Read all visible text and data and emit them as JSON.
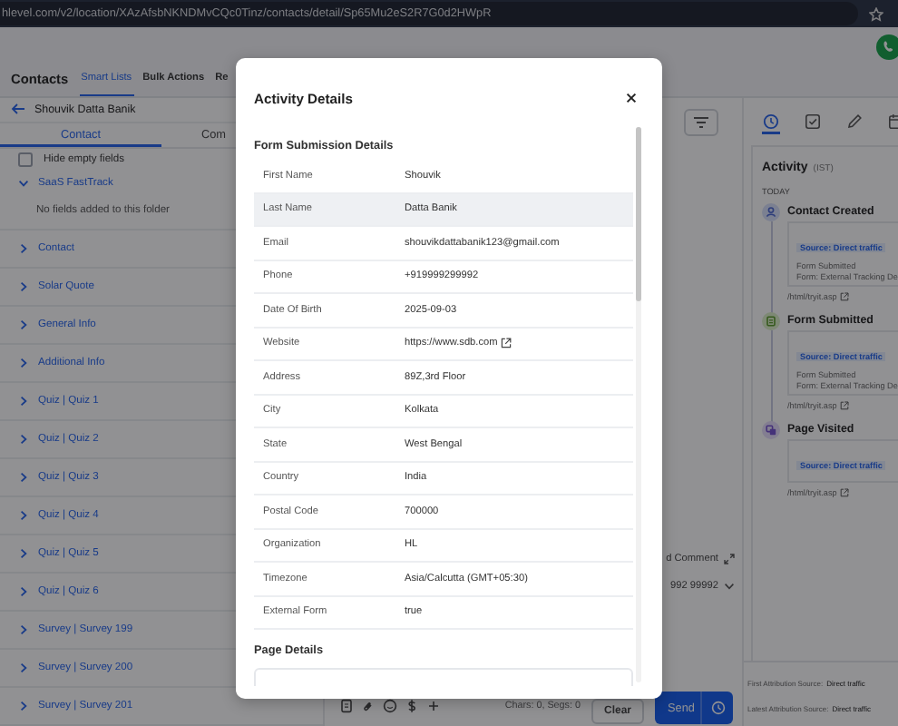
{
  "browser": {
    "url": "hlevel.com/v2/location/XAzAfsbNKNDMvCQc0Tinz/contacts/detail/Sp65Mu2eS2R7G0d2HWpR"
  },
  "nav": {
    "title": "Contacts",
    "tabs": [
      {
        "label": "Smart Lists",
        "selected": true
      },
      {
        "label": "Bulk Actions",
        "selected": false
      },
      {
        "label": "Re",
        "selected": false
      }
    ]
  },
  "contact_panel": {
    "name": "Shouvik Datta Banik",
    "tabs": [
      {
        "label": "Contact",
        "selected": true
      },
      {
        "label": "Com",
        "selected": false
      }
    ],
    "hide_empty": {
      "label": "Hide empty fields",
      "checked": false
    },
    "folders": [
      {
        "label": "SaaS FastTrack",
        "expanded": true,
        "empty_text": "No fields added to this folder"
      },
      {
        "label": "Contact",
        "expanded": false
      },
      {
        "label": "Solar Quote",
        "expanded": false
      },
      {
        "label": "General Info",
        "expanded": false
      },
      {
        "label": "Additional Info",
        "expanded": false
      },
      {
        "label": "Quiz | Quiz 1",
        "expanded": false
      },
      {
        "label": "Quiz | Quiz 2",
        "expanded": false
      },
      {
        "label": "Quiz | Quiz 3",
        "expanded": false
      },
      {
        "label": "Quiz | Quiz 4",
        "expanded": false
      },
      {
        "label": "Quiz | Quiz 5",
        "expanded": false
      },
      {
        "label": "Quiz | Quiz 6",
        "expanded": false
      },
      {
        "label": "Survey | Survey 199",
        "expanded": false
      },
      {
        "label": "Survey | Survey 200",
        "expanded": false
      },
      {
        "label": "Survey | Survey 201",
        "expanded": false
      }
    ]
  },
  "composer": {
    "comment_label": "d Comment",
    "phone": "992 99992",
    "counter": "Chars: 0, Segs: 0",
    "clear": "Clear",
    "send": "Send"
  },
  "activity": {
    "tabs": [
      {
        "selected": true
      },
      {
        "selected": false
      },
      {
        "selected": false
      },
      {
        "selected": false
      }
    ],
    "title": "Activity",
    "timezone": "(IST)",
    "day": "TODAY",
    "events": [
      {
        "kind": "contact",
        "title": "Contact Created",
        "source": "Source: Direct traffic",
        "lines": [
          "Form Submitted",
          "Form: External Tracking De"
        ],
        "link": "/html/tryit.asp"
      },
      {
        "kind": "form",
        "title": "Form Submitted",
        "source": "Source: Direct traffic",
        "lines": [
          "Form Submitted",
          "Form: External Tracking De"
        ],
        "link": "/html/tryit.asp"
      },
      {
        "kind": "page",
        "title": "Page Visited",
        "source": "Source: Direct traffic",
        "link": "/html/tryit.asp"
      }
    ],
    "attribution": [
      {
        "label": "First Attribution Source:",
        "value": "Direct traffic"
      },
      {
        "label": "Latest Attribution Source:",
        "value": "Direct traffic"
      }
    ]
  },
  "modal": {
    "title": "Activity Details",
    "sections": [
      {
        "title": "Form Submission Details",
        "rows": [
          {
            "label": "First Name",
            "value": "Shouvik",
            "kind": "text",
            "highlighted": false
          },
          {
            "label": "Last Name",
            "value": "Datta Banik",
            "kind": "text",
            "highlighted": true
          },
          {
            "label": "Email",
            "value": "shouvikdattabanik123@gmail.com",
            "kind": "text",
            "highlighted": false
          },
          {
            "label": "Phone",
            "value": "+919999299992",
            "kind": "text",
            "highlighted": false
          },
          {
            "label": "Date Of Birth",
            "value": "2025-09-03",
            "kind": "text",
            "highlighted": false
          },
          {
            "label": "Website",
            "value": "https://www.sdb.com",
            "kind": "link",
            "highlighted": false
          },
          {
            "label": "Address",
            "value": "89Z,3rd Floor",
            "kind": "text",
            "highlighted": false
          },
          {
            "label": "City",
            "value": "Kolkata",
            "kind": "text",
            "highlighted": false
          },
          {
            "label": "State",
            "value": "West Bengal",
            "kind": "text",
            "highlighted": false
          },
          {
            "label": "Country",
            "value": "India",
            "kind": "text",
            "highlighted": false
          },
          {
            "label": "Postal Code",
            "value": "700000",
            "kind": "text",
            "highlighted": false
          },
          {
            "label": "Organization",
            "value": "HL",
            "kind": "text",
            "highlighted": false
          },
          {
            "label": "Timezone",
            "value": "Asia/Calcutta (GMT+05:30)",
            "kind": "text",
            "highlighted": false
          },
          {
            "label": "External Form",
            "value": "true",
            "kind": "text",
            "highlighted": false
          }
        ]
      },
      {
        "title": "Page Details"
      }
    ]
  }
}
